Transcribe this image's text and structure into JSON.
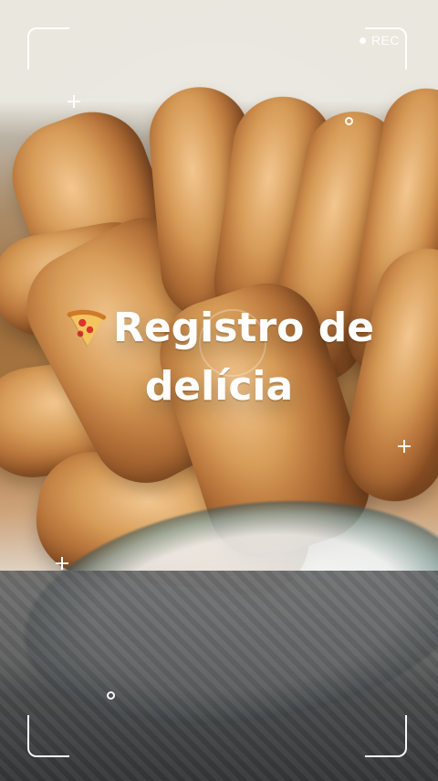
{
  "overlay": {
    "rec_label": "REC",
    "title_line1": "Registro de",
    "title_line2": "delícia"
  },
  "icons": {
    "pizza": "pizza-icon"
  },
  "colors": {
    "overlay_white": "#ffffff"
  }
}
